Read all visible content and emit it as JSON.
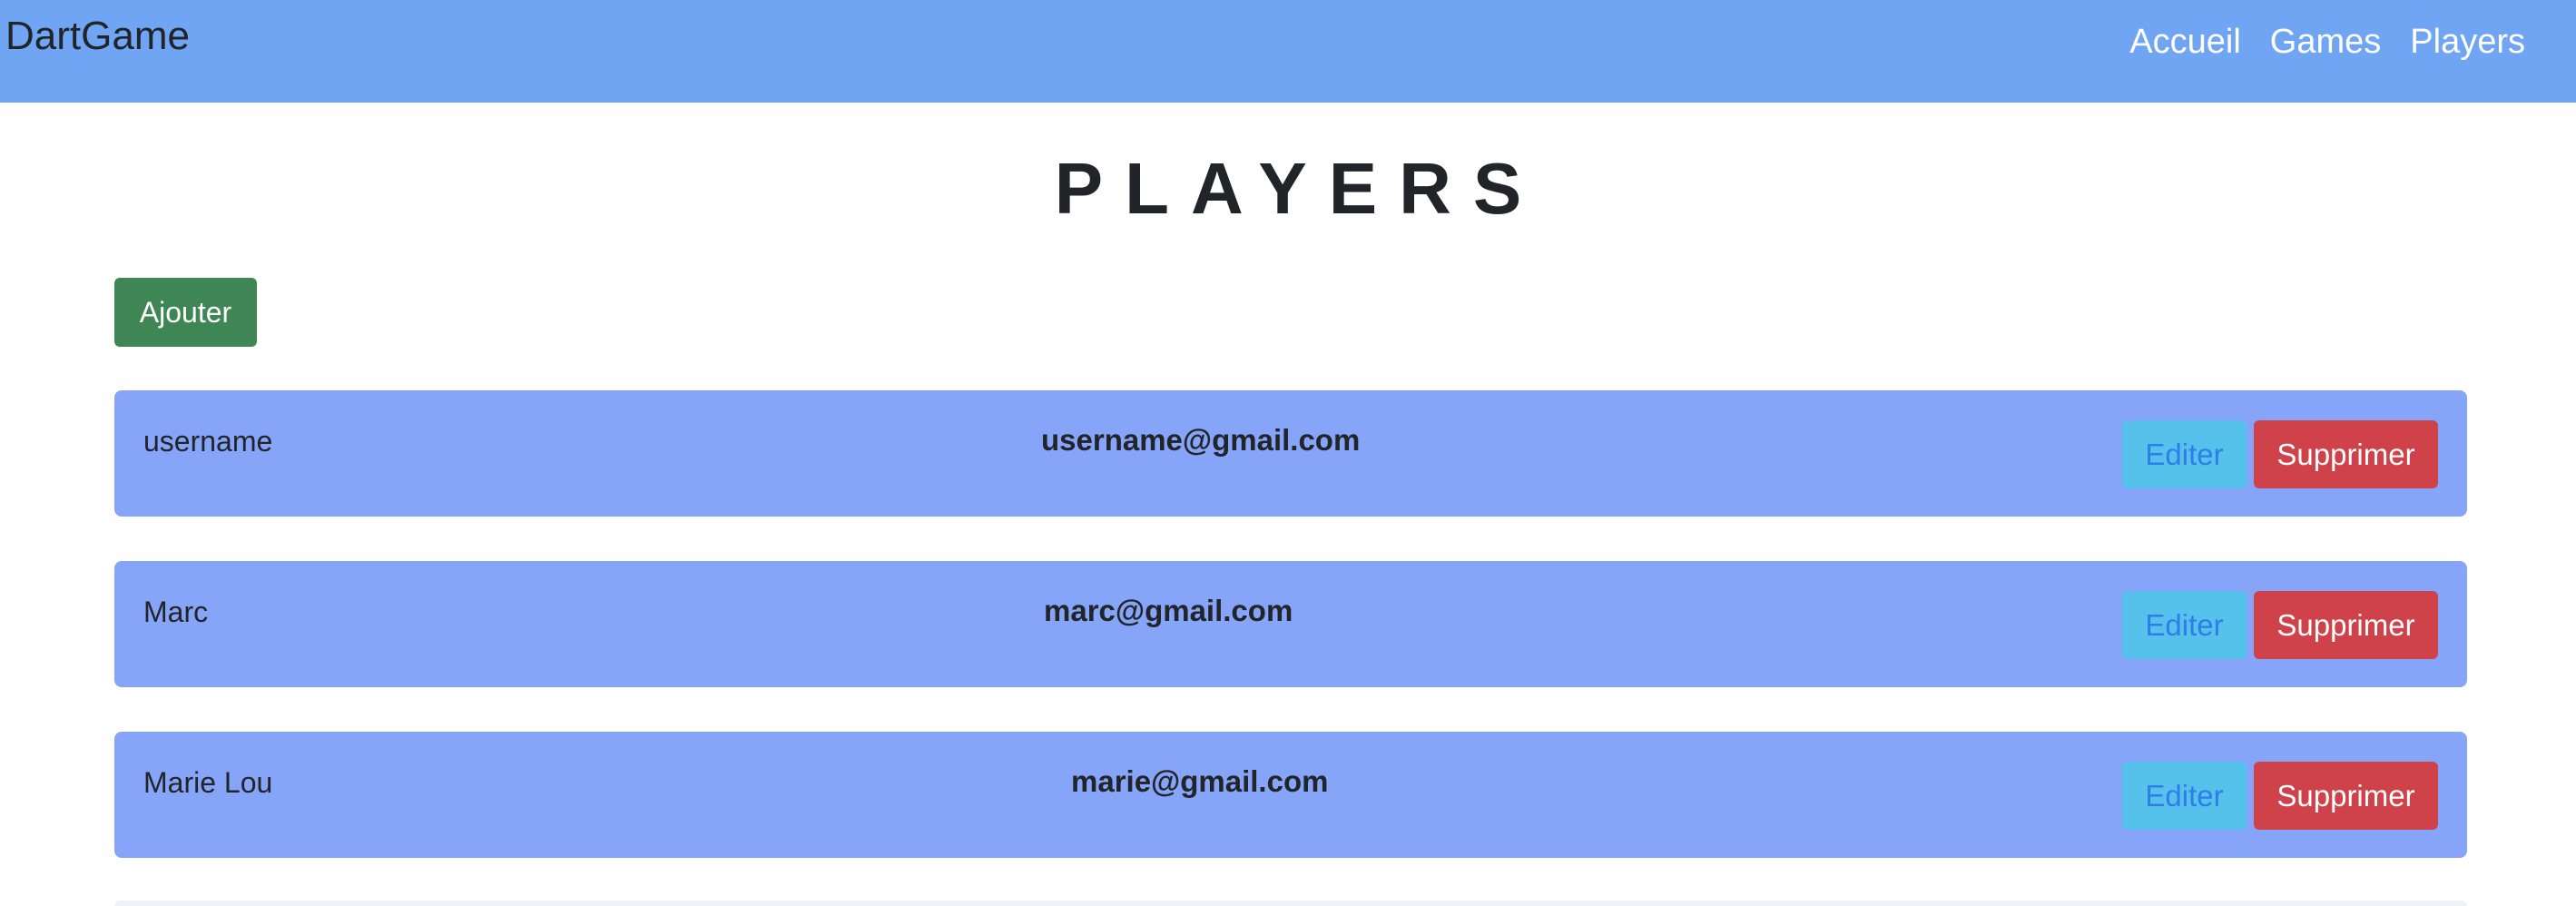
{
  "navbar": {
    "brand": "DartGame",
    "links": [
      "Accueil",
      "Games",
      "Players"
    ]
  },
  "page": {
    "title": "PLAYERS",
    "add_label": "Ajouter"
  },
  "players": [
    {
      "name": "username",
      "email": "username@gmail.com",
      "edit_label": "Editer",
      "delete_label": "Supprimer"
    },
    {
      "name": "Marc",
      "email": "marc@gmail.com",
      "edit_label": "Editer",
      "delete_label": "Supprimer"
    },
    {
      "name": "Marie Lou",
      "email": "marie@gmail.com",
      "edit_label": "Editer",
      "delete_label": "Supprimer"
    }
  ],
  "colors": {
    "navbar": "#70a5f4",
    "card": "#86a4f8",
    "add_button": "#3e8755",
    "edit_button": "#56c2ec",
    "delete_button": "#d0424a"
  }
}
